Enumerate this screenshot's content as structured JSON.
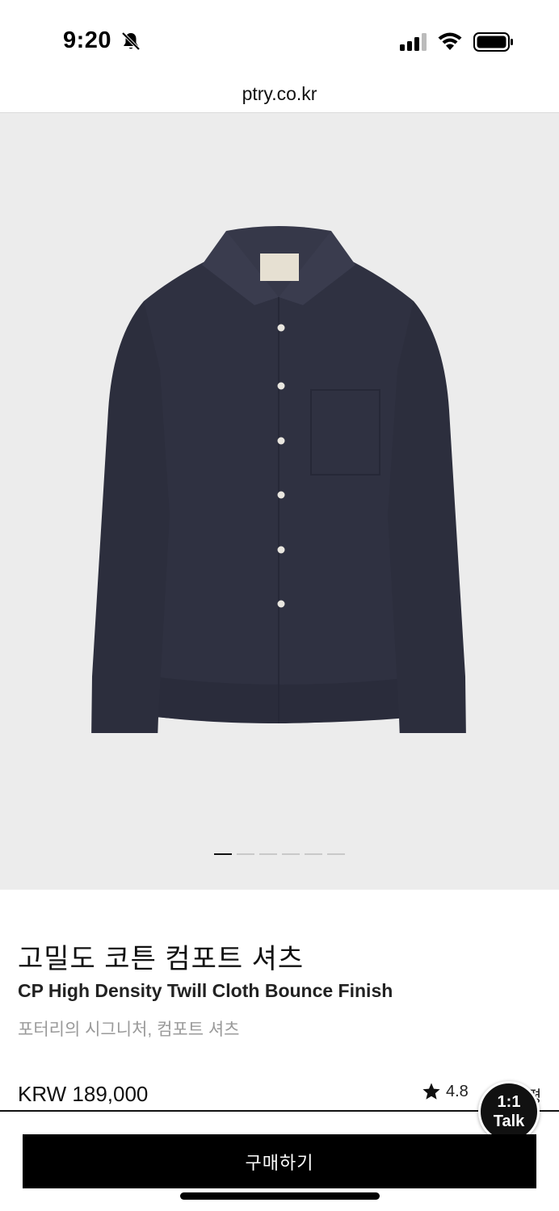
{
  "status_bar": {
    "time": "9:20",
    "icons": [
      "bell-slash-icon",
      "signal-icon",
      "wifi-icon",
      "battery-icon"
    ]
  },
  "browser": {
    "url": "ptry.co.kr"
  },
  "gallery": {
    "image": "navy-shirt-product-photo",
    "slide_count": 6,
    "active_slide": 1
  },
  "product": {
    "title_ko": "고밀도 코튼 컴포트 셔츠",
    "title_en": "CP High Density Twill Cloth Bounce Finish",
    "tagline": "포터리의 시그니처, 컴포트 셔츠",
    "price": "KRW 189,000",
    "rating": "4.8",
    "rating_trailing": "평"
  },
  "talk": {
    "line1": "1:1",
    "line2": "Talk"
  },
  "actions": {
    "buy_label": "구매하기"
  },
  "colors": {
    "gallery_bg": "#ececec",
    "shirt": "#2f3141",
    "button_bg": "#000000"
  }
}
